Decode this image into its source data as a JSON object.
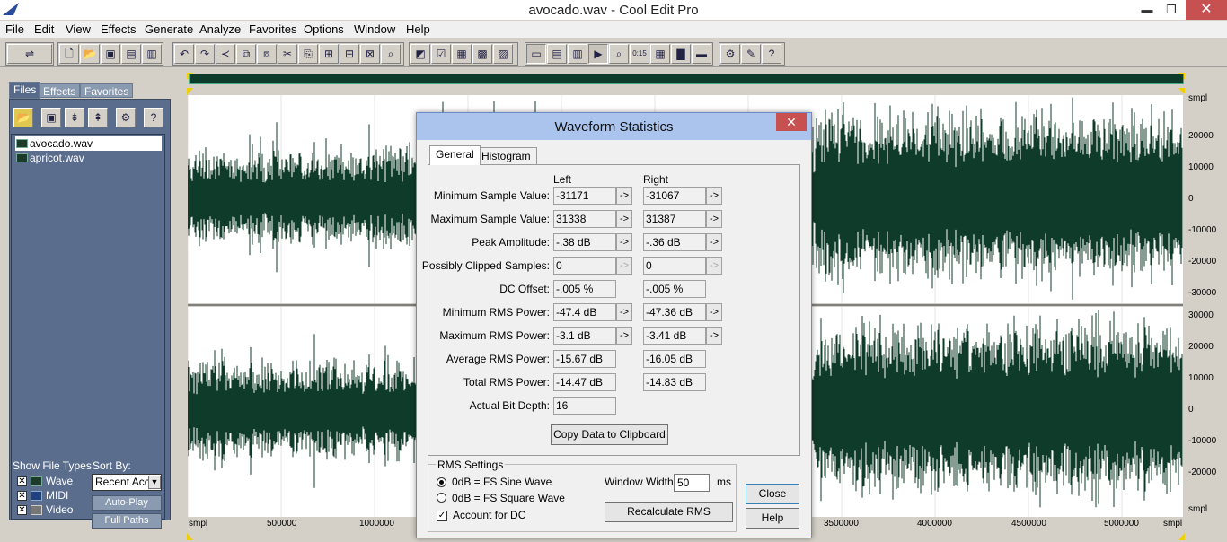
{
  "window": {
    "title": "avocado.wav - Cool Edit Pro",
    "minimize": "▬",
    "maximize": "❐",
    "close": "✕"
  },
  "menu": [
    "File",
    "Edit",
    "View",
    "Effects",
    "Generate",
    "Analyze",
    "Favorites",
    "Options",
    "Window",
    "Help"
  ],
  "left_panel": {
    "tabs": [
      "Files",
      "Effects",
      "Favorites"
    ],
    "files": [
      "avocado.wav",
      "apricot.wav"
    ],
    "show_file_types_label": "Show File Types:",
    "sort_by_label": "Sort By:",
    "types": [
      "Wave",
      "MIDI",
      "Video"
    ],
    "sort_value": "Recent Acc",
    "auto_play": "Auto-Play",
    "full_paths": "Full Paths"
  },
  "ruler_right": {
    "unit": "smpl",
    "top_channel": [
      "20000",
      "10000",
      "0",
      "-10000",
      "-20000",
      "-30000"
    ],
    "bottom_channel": [
      "30000",
      "20000",
      "10000",
      "0",
      "-10000",
      "-20000"
    ]
  },
  "ruler_bottom": {
    "unit_left": "smpl",
    "unit_right": "smpl",
    "ticks": [
      "500000",
      "1000000",
      "3500000",
      "4000000",
      "4500000",
      "5000000"
    ]
  },
  "dialog": {
    "title": "Waveform Statistics",
    "close": "✕",
    "tabs": [
      "General",
      "Histogram"
    ],
    "col_left": "Left",
    "col_right": "Right",
    "rows": [
      {
        "label": "Minimum Sample Value:",
        "left": "-31171",
        "right": "-31067",
        "arrow": true
      },
      {
        "label": "Maximum Sample Value:",
        "left": "31338",
        "right": "31387",
        "arrow": true
      },
      {
        "label": "Peak Amplitude:",
        "left": "-.38 dB",
        "right": "-.36 dB",
        "arrow": true
      },
      {
        "label": "Possibly Clipped Samples:",
        "left": "0",
        "right": "0",
        "arrow": true
      },
      {
        "label": "DC Offset:",
        "left": "-.005 %",
        "right": "-.005 %",
        "arrow": false
      },
      {
        "label": "Minimum RMS Power:",
        "left": "-47.4 dB",
        "right": "-47.36 dB",
        "arrow": true
      },
      {
        "label": "Maximum RMS Power:",
        "left": "-3.1 dB",
        "right": "-3.41 dB",
        "arrow": true
      },
      {
        "label": "Average RMS Power:",
        "left": "-15.67 dB",
        "right": "-16.05 dB",
        "arrow": false
      },
      {
        "label": "Total RMS Power:",
        "left": "-14.47 dB",
        "right": "-14.83 dB",
        "arrow": false
      },
      {
        "label": "Actual Bit Depth:",
        "left": "16",
        "right": "",
        "arrow": false
      }
    ],
    "arrow_glyph": "->",
    "copy_button": "Copy Data to Clipboard",
    "rms": {
      "title": "RMS Settings",
      "opt1": "0dB = FS Sine Wave",
      "opt2": "0dB = FS Square Wave",
      "account_dc": "Account for DC",
      "window_width_label": "Window Width:",
      "window_width": "50",
      "ms": "ms",
      "recalc": "Recalculate RMS"
    },
    "close_button": "Close",
    "help_button": "Help"
  },
  "colors": {
    "wave": "#0f3b2a",
    "dialog_title": "#aac4ee",
    "panel": "#5a6d8c"
  }
}
